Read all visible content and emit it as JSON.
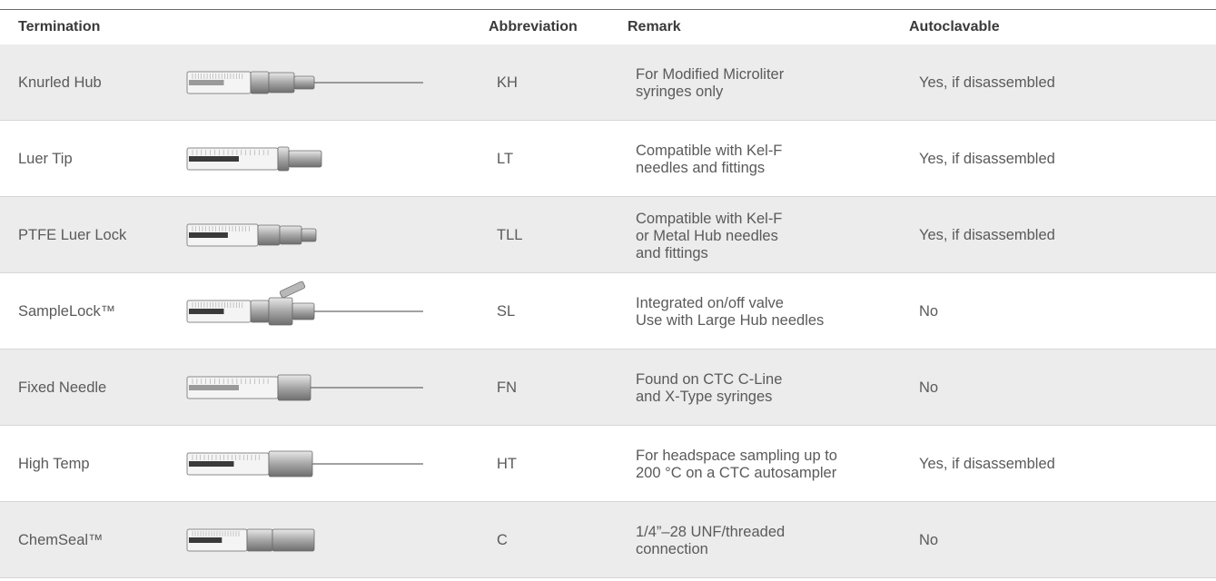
{
  "headers": {
    "termination": "Termination",
    "abbreviation": "Abbreviation",
    "remark": "Remark",
    "autoclavable": "Autoclavable"
  },
  "rows": [
    {
      "termination": "Knurled Hub",
      "image": "knurled-hub-syringe-icon",
      "abbreviation": "KH",
      "remark": [
        "For Modified Microliter",
        "syringes only"
      ],
      "autoclavable": "Yes, if disassembled"
    },
    {
      "termination": "Luer Tip",
      "image": "luer-tip-syringe-icon",
      "abbreviation": "LT",
      "remark": [
        "Compatible with Kel-F",
        "needles and fittings"
      ],
      "autoclavable": "Yes, if disassembled"
    },
    {
      "termination": "PTFE Luer Lock",
      "image": "ptfe-luer-lock-syringe-icon",
      "abbreviation": "TLL",
      "remark": [
        "Compatible with Kel-F",
        "or Metal Hub needles",
        "and fittings"
      ],
      "autoclavable": "Yes, if disassembled"
    },
    {
      "termination": "SampleLock™",
      "image": "samplelock-syringe-icon",
      "abbreviation": "SL",
      "remark": [
        "Integrated on/off valve",
        "Use with Large Hub needles"
      ],
      "autoclavable": "No"
    },
    {
      "termination": "Fixed Needle",
      "image": "fixed-needle-syringe-icon",
      "abbreviation": "FN",
      "remark": [
        "Found on CTC C-Line",
        "and X-Type syringes"
      ],
      "autoclavable": "No"
    },
    {
      "termination": "High Temp",
      "image": "high-temp-syringe-icon",
      "abbreviation": "HT",
      "remark": [
        "For headspace sampling up to",
        "200 °C on a CTC autosampler"
      ],
      "autoclavable": "Yes, if disassembled"
    },
    {
      "termination": "ChemSeal™",
      "image": "chemseal-syringe-icon",
      "abbreviation": "C",
      "remark": [
        "1/4”–28 UNF/threaded",
        "connection"
      ],
      "autoclavable": "No"
    }
  ]
}
